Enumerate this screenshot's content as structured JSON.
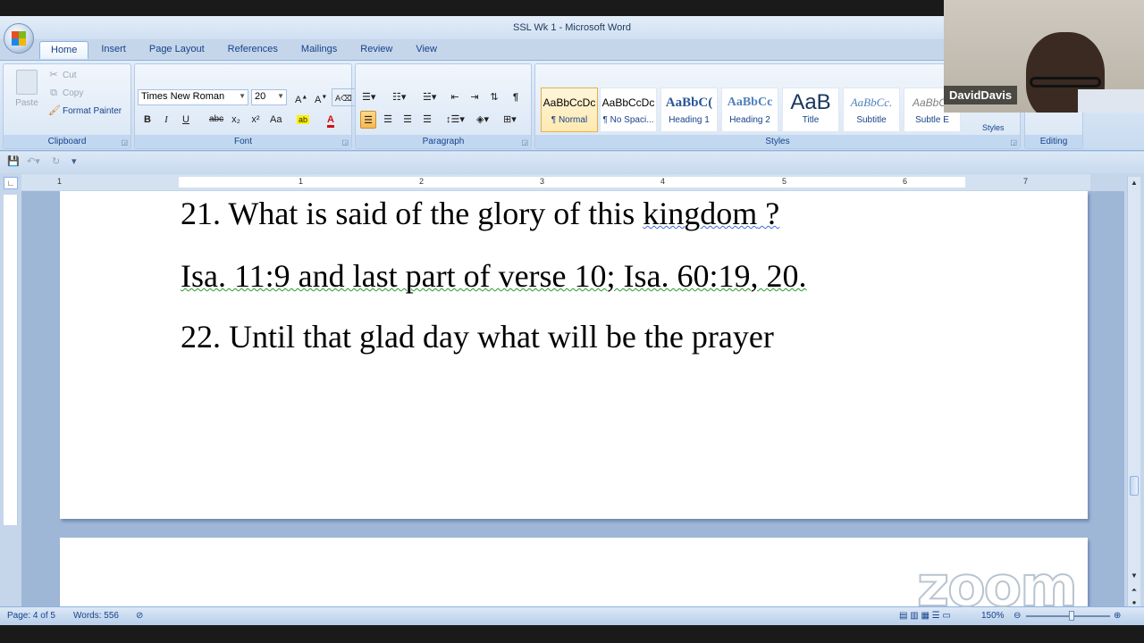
{
  "window": {
    "title": "SSL Wk 1 - Microsoft Word"
  },
  "tabs": [
    "Home",
    "Insert",
    "Page Layout",
    "References",
    "Mailings",
    "Review",
    "View"
  ],
  "clipboard": {
    "label": "Clipboard",
    "paste": "Paste",
    "cut": "Cut",
    "copy": "Copy",
    "format_painter": "Format Painter"
  },
  "font": {
    "label": "Font",
    "name": "Times New Roman",
    "size": "20",
    "bold": "B",
    "italic": "I",
    "underline": "U",
    "strike": "abc",
    "sub": "x₂",
    "sup": "x²",
    "case": "Aa"
  },
  "paragraph": {
    "label": "Paragraph"
  },
  "styles": {
    "label": "Styles",
    "items": [
      {
        "sample": "AaBbCcDc",
        "name": "¶ Normal"
      },
      {
        "sample": "AaBbCcDc",
        "name": "¶ No Spaci..."
      },
      {
        "sample": "AaBbC(",
        "name": "Heading 1"
      },
      {
        "sample": "AaBbCc",
        "name": "Heading 2"
      },
      {
        "sample": "AaB",
        "name": "Title"
      },
      {
        "sample": "AaBbCc.",
        "name": "Subtitle"
      },
      {
        "sample": "AaBbCc",
        "name": "Subtle E"
      }
    ],
    "change_styles": "Styles"
  },
  "editing": {
    "label": "Editing"
  },
  "ruler": {
    "numbers": [
      "1",
      "1",
      "2",
      "3",
      "4",
      "5",
      "6",
      "7"
    ]
  },
  "document": {
    "line1": "21. What is said of the glory of this ",
    "line1_word": "kingdom",
    "line1_end": " ?",
    "line2": "Isa. 11:9 and last part of verse 10; Isa. 60:19, 20.",
    "line3": "22. Until that glad day what will be the prayer"
  },
  "status": {
    "page": "Page: 4 of 5",
    "words": "Words: 556",
    "zoom": "150%"
  },
  "webcam": {
    "name": "DavidDavis"
  },
  "watermark": "zoom"
}
